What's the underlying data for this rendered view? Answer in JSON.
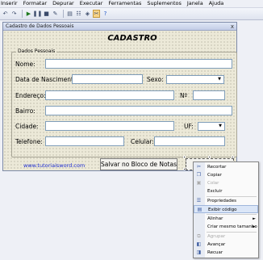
{
  "menubar": {
    "items": [
      {
        "label": "Inserir"
      },
      {
        "label": "Formatar"
      },
      {
        "label": "Depurar"
      },
      {
        "label": "Executar"
      },
      {
        "label": "Ferramentas"
      },
      {
        "label": "Suplementos"
      },
      {
        "label": "Janela"
      },
      {
        "label": "Ajuda"
      }
    ]
  },
  "toolbar": {
    "icons": [
      "undo-icon",
      "redo-icon",
      "run-icon",
      "pause-icon",
      "reset-icon",
      "design-mode-icon",
      "project-explorer-icon",
      "properties-icon",
      "object-browser-icon",
      "toolbox-icon",
      "help-icon"
    ]
  },
  "form": {
    "window_title": "Cadastro de Dados Pessoais",
    "close_glyph": "x",
    "heading": "CADASTRO",
    "frame_caption": "Dados Pessoais",
    "labels": {
      "nome": "Nome:",
      "nascimento": "Data de Nascimento:",
      "sexo": "Sexo:",
      "endereco": "Endereço:",
      "numero": "Nº",
      "bairro": "Bairro:",
      "cidade": "Cidade:",
      "uf": "UF:",
      "telefone": "Telefone:",
      "celular": "Celular:"
    },
    "link_text": "www.tutoriaisword.com",
    "save_button": "Salvar no Bloco de Notas",
    "close_button": "Fechar"
  },
  "context_menu": {
    "items": [
      {
        "label": "Recortar",
        "icon": "cut-icon",
        "enabled": true
      },
      {
        "label": "Copiar",
        "icon": "copy-icon",
        "enabled": true
      },
      {
        "label": "Colar",
        "icon": "paste-icon",
        "enabled": false
      },
      {
        "label": "Excluir",
        "icon": "delete-icon",
        "enabled": true
      },
      {
        "label": "Propriedades",
        "icon": "properties-icon",
        "enabled": true
      },
      {
        "label": "Exibir código",
        "icon": "view-code-icon",
        "enabled": true,
        "highlighted": true
      },
      {
        "label": "Alinhar",
        "icon": "",
        "enabled": true,
        "submenu": true
      },
      {
        "label": "Criar mesmo tamanho",
        "icon": "",
        "enabled": true,
        "submenu": true
      },
      {
        "label": "Agrupar",
        "icon": "group-icon",
        "enabled": false
      },
      {
        "label": "Avançar",
        "icon": "bring-forward-icon",
        "enabled": true
      },
      {
        "label": "Recuar",
        "icon": "send-backward-icon",
        "enabled": true
      }
    ]
  }
}
